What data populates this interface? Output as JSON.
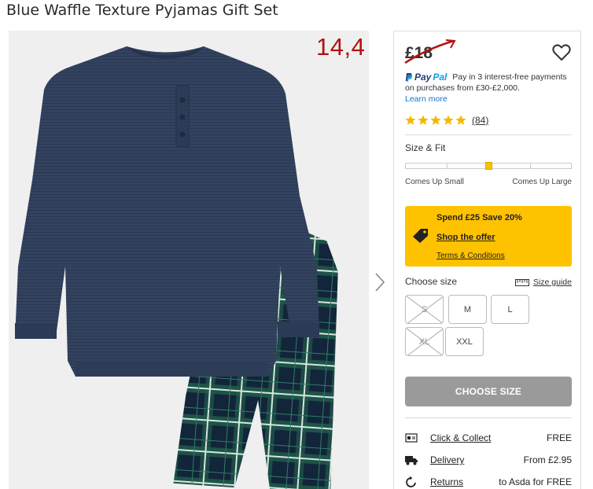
{
  "product": {
    "title": "Blue Waffle Texture Pyjamas Gift Set"
  },
  "annotation": {
    "price_text": "14,4",
    "color": "#b31212"
  },
  "price": {
    "current": "£18"
  },
  "paypal": {
    "brand_pay": "Pay",
    "brand_pal": "Pal",
    "text": "Pay in 3 interest-free payments on purchases from £30-£2,000.",
    "learn_more": "Learn more"
  },
  "rating": {
    "stars": 5,
    "count": "(84)"
  },
  "fit": {
    "title": "Size & Fit",
    "left_label": "Comes Up Small",
    "right_label": "Comes Up Large",
    "position": 0.5
  },
  "offer": {
    "title": "Spend £25 Save 20%",
    "link": "Shop the offer",
    "terms": "Terms & Conditions",
    "color": "#ffc200"
  },
  "sizes": {
    "label": "Choose size",
    "guide": "Size guide",
    "options": [
      {
        "label": "S",
        "available": false
      },
      {
        "label": "M",
        "available": true
      },
      {
        "label": "L",
        "available": true
      },
      {
        "label": "XL",
        "available": false
      },
      {
        "label": "XXL",
        "available": true
      }
    ]
  },
  "cta": {
    "label": "CHOOSE SIZE"
  },
  "delivery": [
    {
      "label": "Click & Collect",
      "value": "FREE",
      "icon": "store-icon"
    },
    {
      "label": "Delivery",
      "value": "From £2.95",
      "icon": "truck-icon"
    },
    {
      "label": "Returns",
      "value": "to Asda for FREE",
      "icon": "return-icon"
    }
  ]
}
